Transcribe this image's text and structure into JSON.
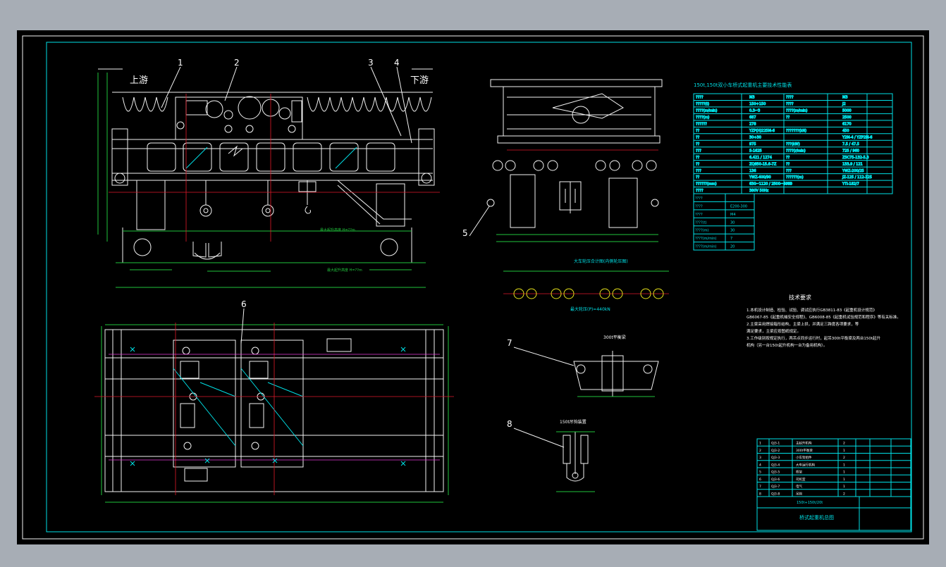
{
  "drawing": {
    "upstream_label": "上游",
    "downstream_label": "下游",
    "callouts": [
      "1",
      "2",
      "3",
      "4",
      "5",
      "6",
      "7",
      "8"
    ],
    "spec_table": {
      "title": "150t,150t双小车桥式起重机主要技术性能表",
      "rows": [
        [
          "????",
          "M3",
          "????",
          "M3"
        ],
        [
          "?????(t)",
          "150+150",
          "????",
          "J2"
        ],
        [
          "????(m/min)",
          "0.3~3",
          "????(m/min)",
          "5000"
        ],
        [
          "????(m)",
          "687",
          "??",
          "2500"
        ],
        [
          "??????",
          "278",
          "",
          "6170"
        ],
        [
          "??",
          "YZP(H)225M-6",
          "???????(kN)",
          "450"
        ],
        [
          "??",
          "30+30",
          "",
          "Y2M-4 / YZP2M-6"
        ],
        [
          "??",
          "975",
          "???(kW)",
          "7.5 / 47.5"
        ],
        [
          "???",
          "S-1625",
          "????(r/min)",
          "725 / 960"
        ],
        [
          "??",
          "6.421 / 1274",
          "??",
          "ZSC75-132-5.3"
        ],
        [
          "??",
          "ZQ850-15.6-7Z",
          "??",
          "133.9 / 121"
        ],
        [
          "???",
          "136",
          "???",
          "YWZ-200/25"
        ],
        [
          "??",
          "YWZ-400/90",
          "??????(m)",
          "JZ-125 / 112-125"
        ],
        [
          "??????(mm)",
          "630~1120 / 2500~4000",
          "???",
          "YTI-182/7"
        ],
        [
          "????",
          "380V  50Hz",
          "",
          ""
        ]
      ],
      "sub_rows": [
        [
          "????",
          ""
        ],
        [
          "????",
          "E200-300"
        ],
        [
          "????",
          "M4"
        ],
        [
          "????(t)",
          "30"
        ],
        [
          "????(m)",
          "30"
        ],
        [
          "????(m/min)",
          "7"
        ],
        [
          "????(m/min)",
          "20"
        ]
      ]
    },
    "tech_notes": {
      "title": "技术要求",
      "lines": [
        "1.本机设计制造、检验、试验、调试应执行GB3811-83《起重机设计规范》",
        "  GB6067-85《起重机械安全规程》、GB6008-85《起重机试验规范和程序》等有关标准。",
        "2.主梁采用焊接箱形结构，主梁上拱，并满足三跨度各项要求，等",
        "  满足要求，主梁应按图纸规定。",
        "3.工作级别按规定执行，两吊点同步运行时，起吊300t平衡梁及两台150t起升",
        "  机构（另一台150t起升机构一台为备用机构）。"
      ]
    },
    "wheel_row_label": "大车轮压合计图(内侧轮压图)",
    "wheel_row_label2": "最大轮压(P)=440kN",
    "spreader_label": "300t平衡梁",
    "hook_label": "150t吊钩装置",
    "title_block": {
      "drawing_title": "桥式起重机总图",
      "code": "150t+150t/20t",
      "rows": [
        [
          "1",
          "QJ3-1",
          "主起升机构",
          "2"
        ],
        [
          "2",
          "QJ3-2",
          "300t平衡梁",
          "1"
        ],
        [
          "3",
          "QJ3-3",
          "小车架组件",
          "2"
        ],
        [
          "4",
          "QJ3-4",
          "大车运行机构",
          "1"
        ],
        [
          "5",
          "QJ3-5",
          "桥架",
          "1"
        ],
        [
          "6",
          "QJ3-6",
          "司机室",
          "1"
        ],
        [
          "7",
          "QJ3-7",
          "电气",
          "1"
        ],
        [
          "8",
          "QJ3-8",
          "吊钩",
          "2"
        ]
      ]
    }
  },
  "colors": {
    "background": "#000000",
    "frame": "#00e0e6",
    "geometry": "#f2f2f2",
    "dimension": "#21c43c",
    "centerline": "#e0182a",
    "note": "#e7e21a"
  }
}
